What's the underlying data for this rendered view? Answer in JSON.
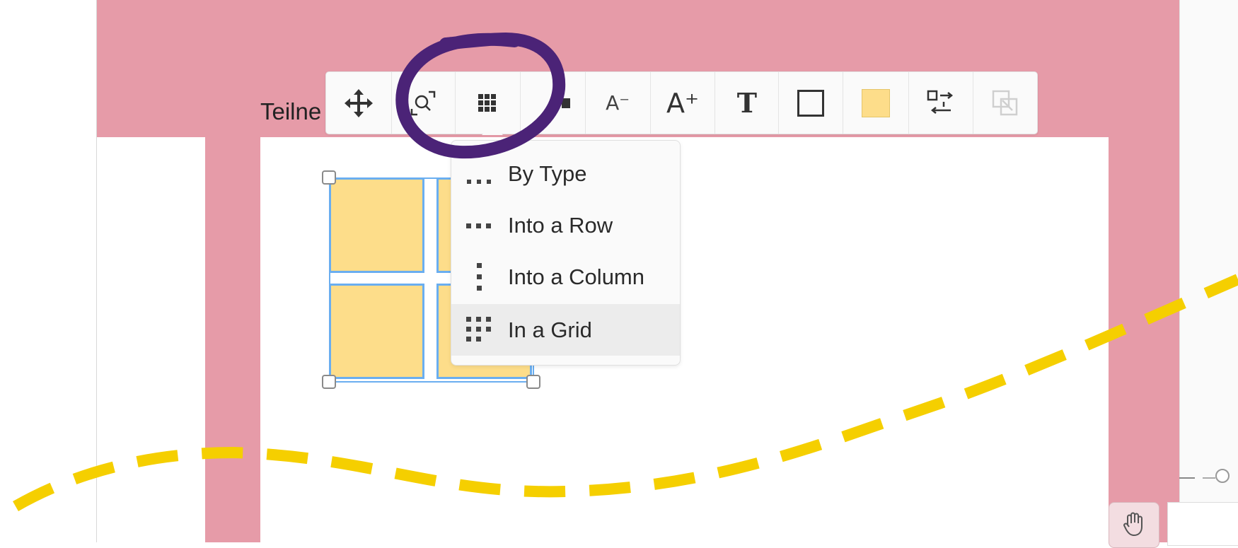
{
  "frame": {
    "title": "Teilne"
  },
  "toolbar": {
    "buttons": [
      {
        "name": "move-button",
        "icon": "move-arrows-icon"
      },
      {
        "name": "zoom-to-fit-button",
        "icon": "zoom-fit-icon"
      },
      {
        "name": "arrange-button",
        "icon": "grid-dots-icon",
        "active": true
      },
      {
        "name": "hidden-button",
        "icon": "unknown-icon"
      },
      {
        "name": "decrease-font-button",
        "icon": "font-decrease-icon",
        "label": "A⁻"
      },
      {
        "name": "increase-font-button",
        "icon": "font-increase-icon",
        "label": "A⁺"
      },
      {
        "name": "text-style-button",
        "icon": "text-icon",
        "label": "T"
      },
      {
        "name": "border-button",
        "icon": "border-square-icon"
      },
      {
        "name": "fill-color-button",
        "icon": "color-swatch-icon",
        "color": "#fddd8a"
      },
      {
        "name": "swap-button",
        "icon": "swap-icon"
      },
      {
        "name": "expand-button",
        "icon": "expand-icon",
        "disabled": true
      }
    ]
  },
  "arrange_menu": {
    "items": [
      {
        "label": "By Type",
        "icon": "by-type-icon"
      },
      {
        "label": "Into a Row",
        "icon": "row-dots-icon"
      },
      {
        "label": "Into a Column",
        "icon": "column-dots-icon"
      },
      {
        "label": "In a Grid",
        "icon": "grid-dots-icon",
        "highlighted": true
      }
    ]
  },
  "colors": {
    "board": "#e69ba8",
    "sticky": "#fddd8a",
    "selection": "#6aaef0",
    "annotation_circle": "#4b2377",
    "annotation_dash": "#f5cf00"
  }
}
